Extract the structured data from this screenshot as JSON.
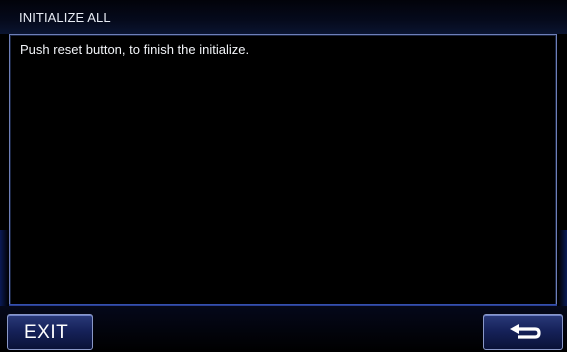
{
  "title": "INITIALIZE ALL",
  "message": "Push reset button, to finish the initialize.",
  "footer": {
    "exit_label": "EXIT",
    "back_icon": "return-arrow-icon"
  },
  "colors": {
    "border": "#6e7fb8",
    "button_fill": "#16225a",
    "background": "#000000"
  }
}
